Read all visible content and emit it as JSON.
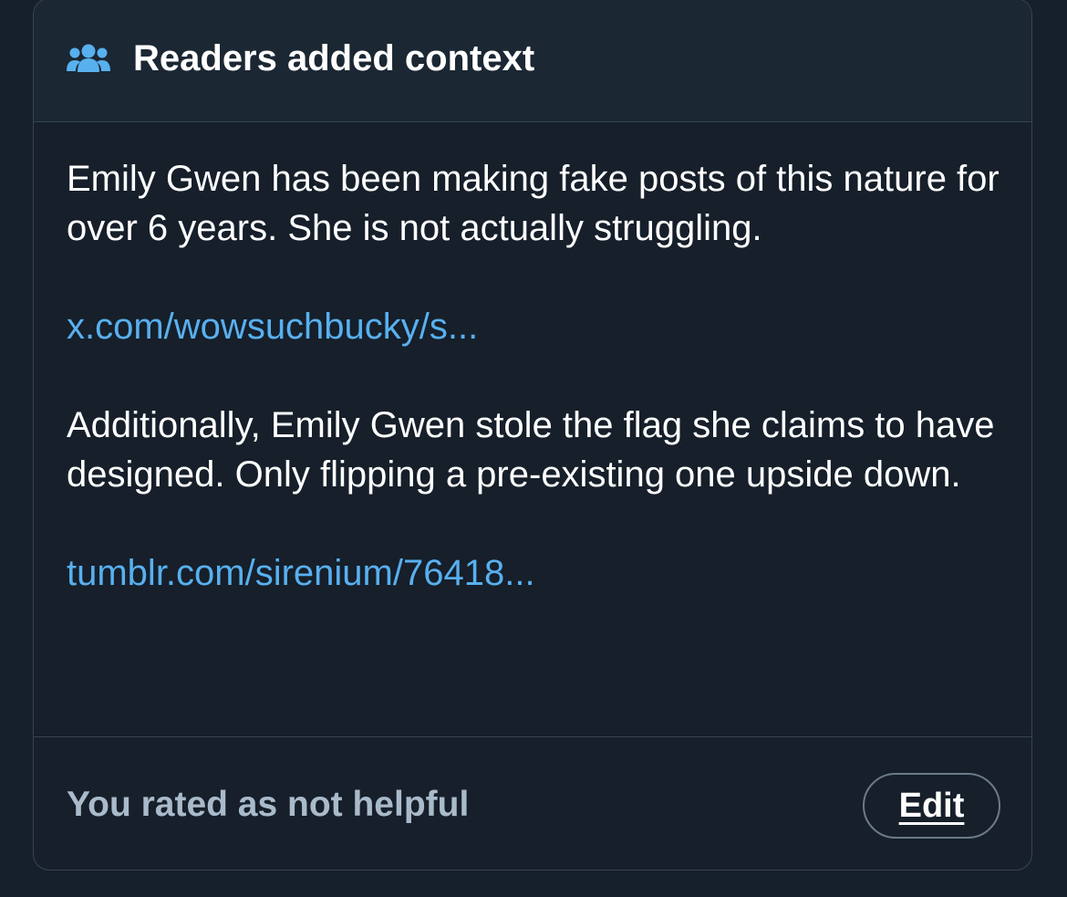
{
  "header": {
    "icon": "people-icon",
    "title": "Readers added context"
  },
  "note": {
    "paragraph_1": "Emily Gwen has been making fake posts of this nature for over 6 years. She is not actually struggling.",
    "link_1": "x.com/wowsuchbucky/s...",
    "paragraph_2": "Additionally, Emily Gwen stole the flag she claims to have designed. Only flipping a pre-existing one upside down.",
    "link_2": "tumblr.com/sirenium/76418..."
  },
  "footer": {
    "rating_text": "You rated as not helpful",
    "edit_label": "Edit"
  },
  "colors": {
    "background": "#15202b",
    "header_background": "#1b2733",
    "link": "#58b0ef",
    "muted_text": "#a9bacb",
    "border": "#38444d"
  }
}
